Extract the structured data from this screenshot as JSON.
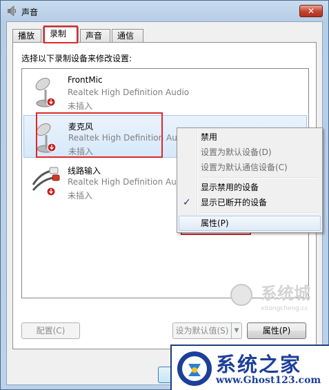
{
  "window": {
    "title": "声音",
    "close_glyph": "✕"
  },
  "tabs": [
    {
      "label": "播放"
    },
    {
      "label": "录制"
    },
    {
      "label": "声音"
    },
    {
      "label": "通信"
    }
  ],
  "panel": {
    "instruction": "选择以下录制设备来修改设置:",
    "devices": [
      {
        "name": "FrontMic",
        "driver": "Realtek High Definition Audio",
        "status": "未插入",
        "icon": "microphone-icon"
      },
      {
        "name": "麦克风",
        "driver": "Realtek High Definition Audio",
        "status": "未插入",
        "icon": "microphone-icon"
      },
      {
        "name": "线路输入",
        "driver": "Realtek High Definition Audio",
        "status": "未插入",
        "icon": "line-in-icon"
      }
    ]
  },
  "buttons": {
    "configure": "配置(C)",
    "set_default": "设为默认值(S)",
    "properties": "属性(P)"
  },
  "context_menu": {
    "items": [
      {
        "label": "禁用"
      },
      {
        "label": "设置为默认设备(D)"
      },
      {
        "label": "设置为默认通信设备(C)"
      },
      {
        "label": "显示禁用的设备"
      },
      {
        "label": "显示已断开的设备"
      },
      {
        "label": "属性(P)"
      }
    ],
    "check_glyph": "✓"
  },
  "watermark": {
    "text": "系统城",
    "url": "xitongcheng.cc"
  },
  "banner": {
    "title": "系统之家",
    "url": "www.Ghost123.com"
  },
  "colors": {
    "highlight_red": "#e0262b",
    "selection_blue": "#d6e8fa",
    "banner_blue": "#1c3f9a"
  }
}
